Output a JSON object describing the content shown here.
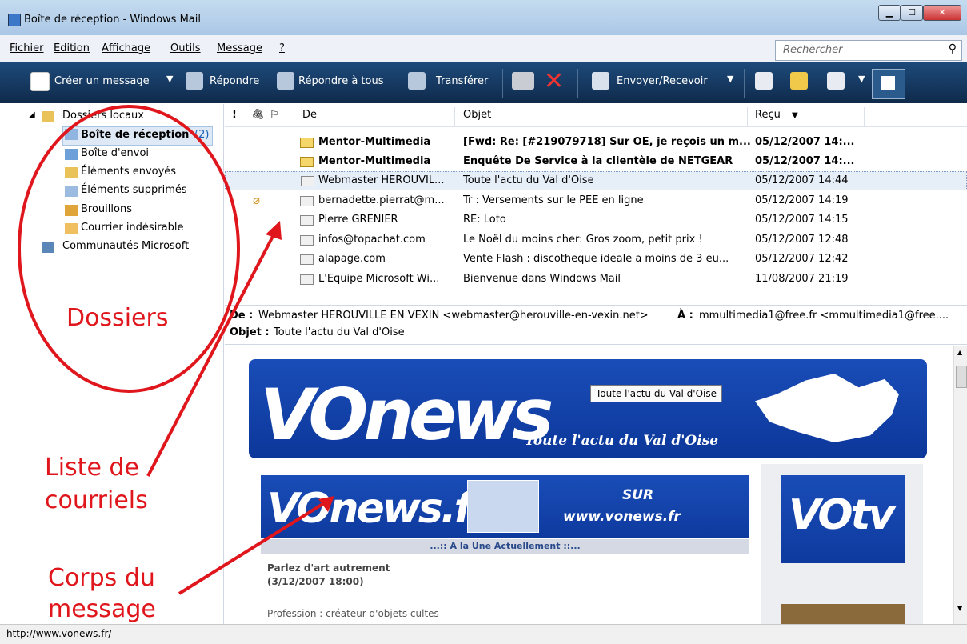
{
  "window": {
    "title": "Boîte de réception - Windows Mail"
  },
  "menubar": {
    "items": [
      "Fichier",
      "Edition",
      "Affichage",
      "Outils",
      "Message",
      "?"
    ]
  },
  "search": {
    "placeholder": "Rechercher",
    "icon": "search-icon"
  },
  "toolbar": {
    "create": "Créer un message",
    "reply": "Répondre",
    "reply_all": "Répondre à tous",
    "forward": "Transférer",
    "send_receive": "Envoyer/Recevoir"
  },
  "folders": {
    "root": "Dossiers locaux",
    "items": [
      {
        "label": "Boîte de réception",
        "count": "(2)",
        "selected": true
      },
      {
        "label": "Boîte d'envoi"
      },
      {
        "label": "Éléments envoyés"
      },
      {
        "label": "Éléments supprimés"
      },
      {
        "label": "Brouillons"
      },
      {
        "label": "Courrier indésirable"
      }
    ],
    "communities": "Communautés Microsoft"
  },
  "list": {
    "columns": {
      "priority": "!",
      "attachment": "🖇",
      "flag": "⚐",
      "from": "De",
      "subject": "Objet",
      "received": "Reçu"
    },
    "rows": [
      {
        "from": "Mentor-Multimedia",
        "subject": "[Fwd: Re: [#219079718] Sur OE, je reçois un m...",
        "received": "05/12/2007 14:...",
        "unread": true
      },
      {
        "from": "Mentor-Multimedia",
        "subject": "Enquête De Service à la clientèle de NETGEAR",
        "received": "05/12/2007 14:...",
        "unread": true
      },
      {
        "from": "Webmaster HEROUVIL...",
        "subject": "Toute l'actu du Val d'Oise",
        "received": "05/12/2007 14:44",
        "selected": true
      },
      {
        "from": "bernadette.pierrat@m...",
        "subject": "Tr : Versements sur le PEE en ligne",
        "received": "05/12/2007 14:19",
        "attachment": true
      },
      {
        "from": "Pierre GRENIER",
        "subject": "RE: Loto",
        "received": "05/12/2007 14:15"
      },
      {
        "from": "infos@topachat.com",
        "subject": " Le Noël du moins cher: Gros zoom, petit prix !",
        "received": "05/12/2007 12:48"
      },
      {
        "from": "alapage.com",
        "subject": "Vente Flash : discotheque ideale a moins de 3 eu...",
        "received": "05/12/2007 12:42"
      },
      {
        "from": "L'Équipe Microsoft Wi...",
        "subject": "Bienvenue dans Windows Mail",
        "received": "11/08/2007 21:19"
      }
    ]
  },
  "preview": {
    "from_label": "De :",
    "from_value": "Webmaster HEROUVILLE EN VEXIN <webmaster@herouville-en-vexin.net>",
    "to_label": "À :",
    "to_value": "mmultimedia1@free.fr <mmultimedia1@free....",
    "subject_label": "Objet :",
    "subject_value": "Toute l'actu du Val d'Oise"
  },
  "body": {
    "banner_logo": "VOnews",
    "banner_tagline": "Toute l'actu du Val d'Oise",
    "banner_tooltip": "Toute l'actu du Val d'Oise",
    "ad_logo": "VOnews.fr",
    "ad_sur": "SUR",
    "ad_url": "www.vonews.fr",
    "une": "...:: A la Une Actuellement ::...",
    "article_title": "Parlez d'art autrement",
    "article_date": "(3/12/2007 18:00)",
    "article_text": "Profession : créateur d'objets cultes",
    "votv": "VOtv"
  },
  "statusbar": {
    "text": "http://www.vonews.fr/"
  },
  "annotations": {
    "dossiers": "Dossiers",
    "liste_1": "Liste de",
    "liste_2": "courriels",
    "corps_1": "Corps du",
    "corps_2": "message"
  },
  "colors": {
    "annotation": "#e0161d",
    "toolbar": "#15375e",
    "banner": "#1140a8"
  }
}
